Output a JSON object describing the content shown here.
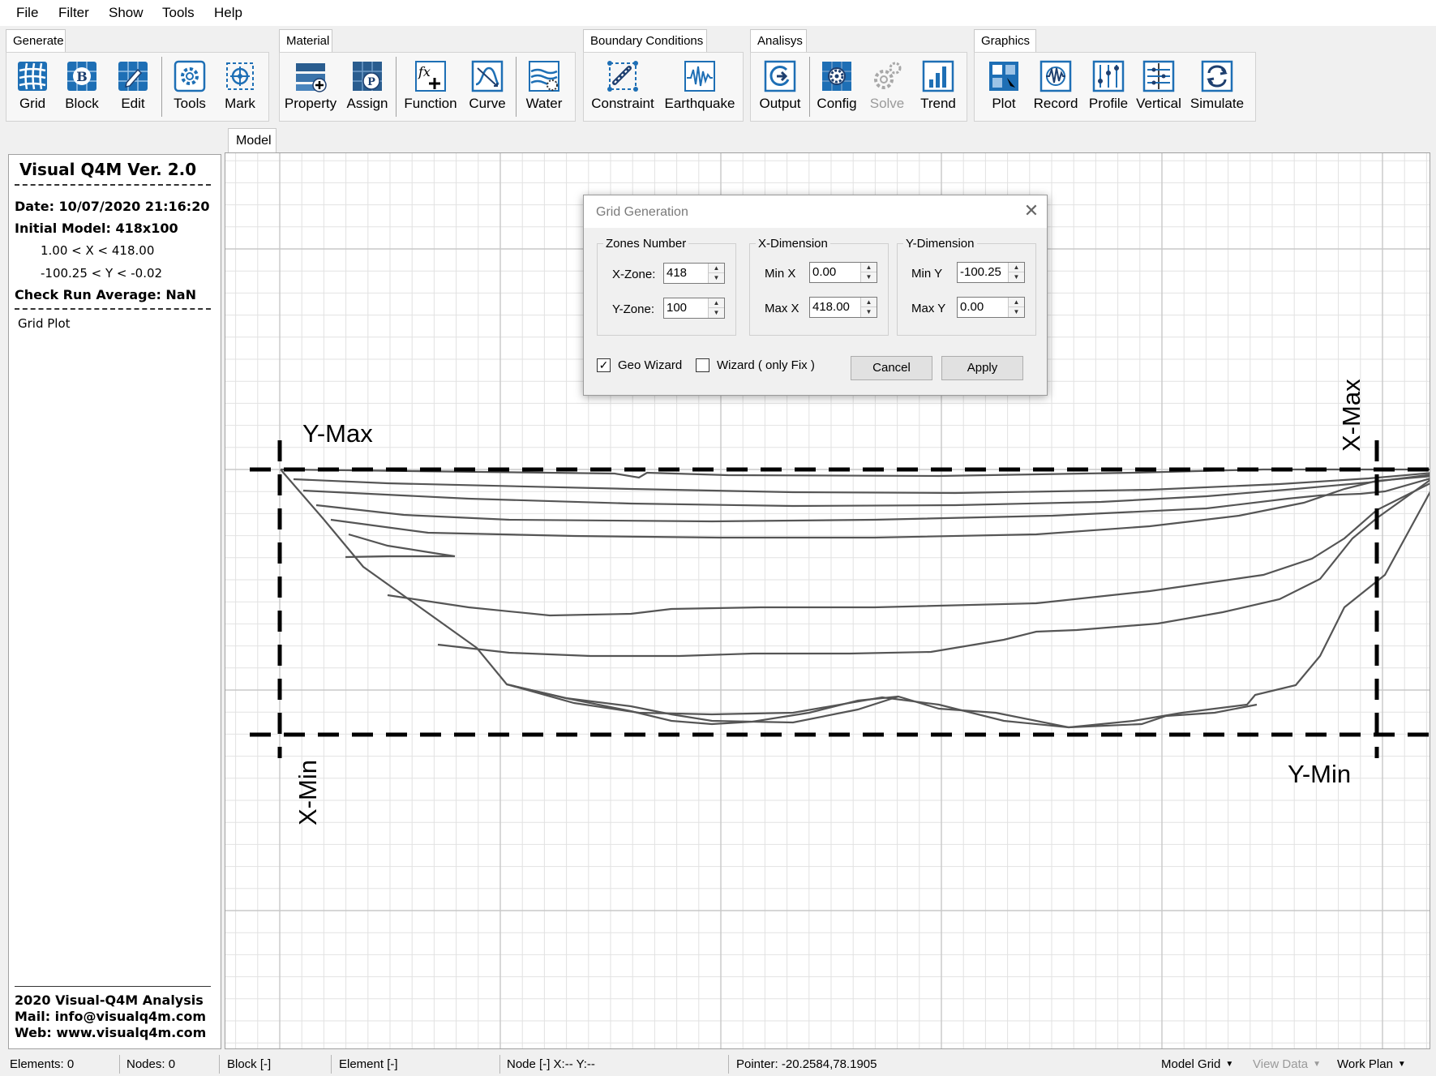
{
  "menu": [
    "File",
    "Filter",
    "Show",
    "Tools",
    "Help"
  ],
  "ribbon": {
    "groups": [
      {
        "label": "Generate",
        "buttons": [
          "Grid",
          "Block",
          "Edit",
          "Tools",
          "Mark"
        ]
      },
      {
        "label": "Material",
        "buttons": [
          "Property",
          "Assign",
          "Function",
          "Curve",
          "Water"
        ]
      },
      {
        "label": "Boundary Conditions",
        "buttons": [
          "Constraint",
          "Earthquake"
        ]
      },
      {
        "label": "Analisys",
        "buttons": [
          "Output",
          "Config",
          "Solve",
          "Trend"
        ]
      },
      {
        "label": "Graphics",
        "buttons": [
          "Plot",
          "Record",
          "Profile",
          "Vertical",
          "Simulate"
        ]
      }
    ],
    "disabled_buttons": [
      "Solve"
    ],
    "icon_names": [
      "grid-icon",
      "block-icon",
      "edit-icon",
      "tools-icon",
      "mark-icon",
      "property-icon",
      "assign-icon",
      "function-icon",
      "curve-icon",
      "water-icon",
      "constraint-icon",
      "earthquake-icon",
      "output-icon",
      "config-icon",
      "solve-icon",
      "trend-icon",
      "plot-icon",
      "record-icon",
      "profile-icon",
      "vertical-icon",
      "simulate-icon"
    ],
    "icon_color": "#1e6fb5"
  },
  "left_panel": {
    "title": "Visual Q4M Ver. 2.0",
    "date": "Date: 10/07/2020 21:16:20",
    "initial_model": "Initial Model: 418x100",
    "x_range": "1.00 < X < 418.00",
    "y_range": "-100.25 < Y < -0.02",
    "check_run": "Check Run Average: NaN",
    "plot_label": "Grid Plot",
    "footer": [
      "2020 Visual-Q4M Analysis",
      "Mail: info@visualq4m.com",
      "Web: www.visualq4m.com"
    ]
  },
  "canvas": {
    "tab_label": "Model",
    "labels": {
      "y_max": "Y-Max",
      "x_max": "X-Max",
      "x_min": "X-Min",
      "y_min": "Y-Min"
    },
    "line_color": "#555555",
    "grid_color": "#e2e2e2"
  },
  "dialog": {
    "title": "Grid Generation",
    "zones": {
      "legend": "Zones Number",
      "x_label": "X-Zone:",
      "x_value": "418",
      "y_label": "Y-Zone:",
      "y_value": "100"
    },
    "x_dim": {
      "legend": "X-Dimension",
      "min_label": "Min X",
      "min_value": "0.00",
      "max_label": "Max X",
      "max_value": "418.00"
    },
    "y_dim": {
      "legend": "Y-Dimension",
      "min_label": "Min Y",
      "min_value": "-100.25",
      "max_label": "Max Y",
      "max_value": "0.00"
    },
    "geo_wizard": {
      "label": "Geo Wizard",
      "checked": true
    },
    "wizard_fix": {
      "label": "Wizard ( only Fix )",
      "checked": false
    },
    "cancel": "Cancel",
    "apply": "Apply"
  },
  "status": {
    "elements": "Elements: 0",
    "nodes": "Nodes: 0",
    "block": "Block [-]",
    "element": "Element [-]",
    "node": "Node [-]  X:-- Y:--",
    "pointer": "Pointer: -20.2584,78.1905",
    "model_grid": "Model Grid",
    "view_data": "View Data",
    "work_plan": "Work Plan"
  }
}
